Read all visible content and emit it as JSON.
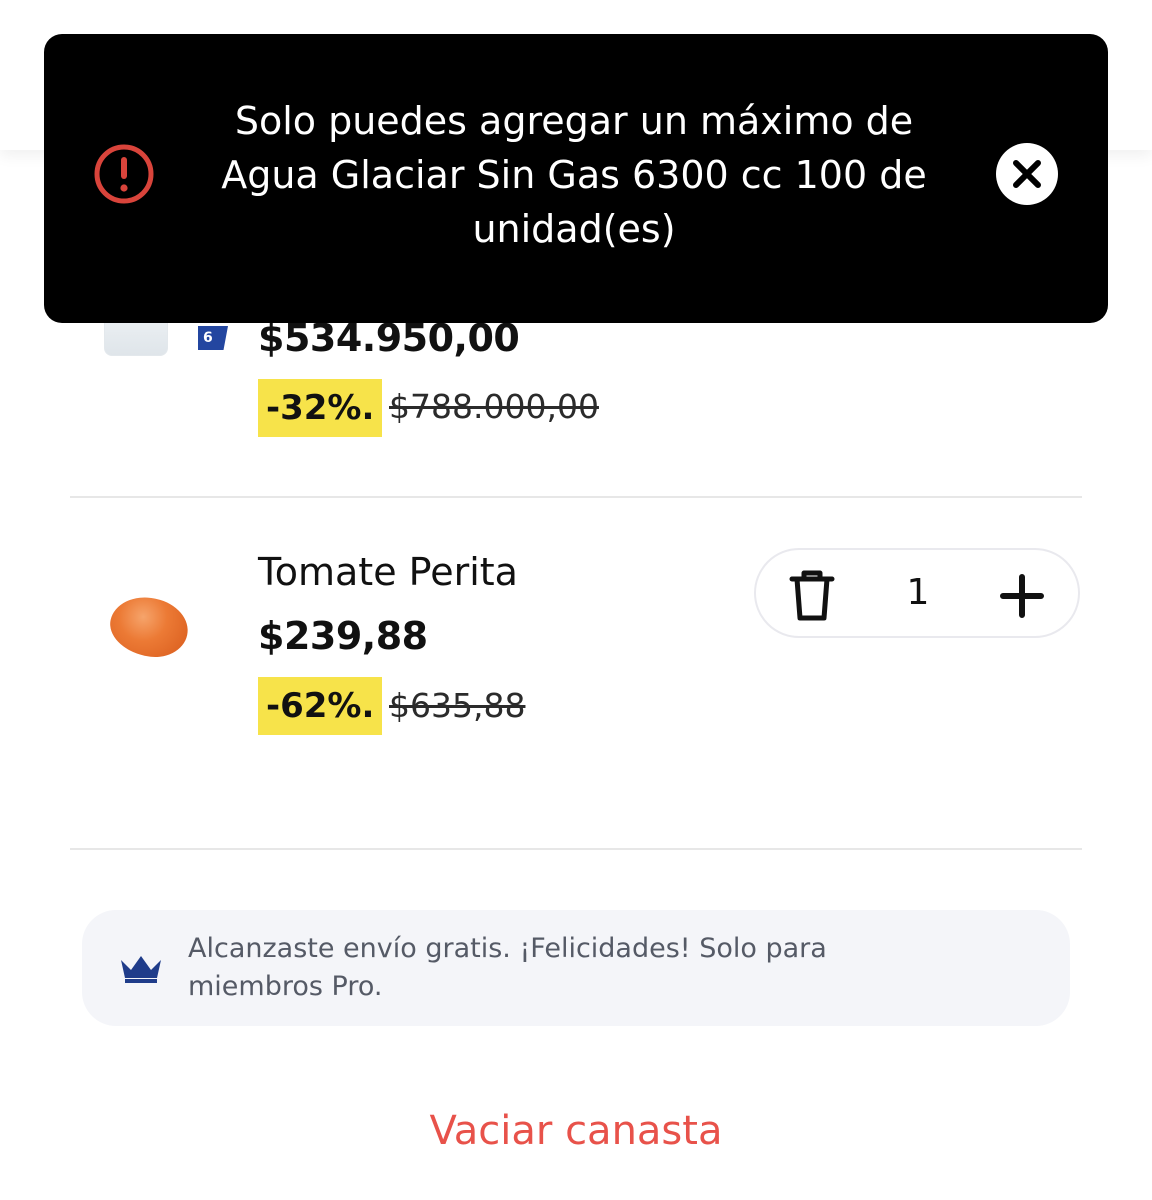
{
  "toast": {
    "message": "Solo puedes agregar un máximo de Agua Glaciar Sin Gas 6300 cc 100 de unidad(es)",
    "icon": "alert-circle-icon",
    "close_icon": "close-icon",
    "icon_color": "#d9443b"
  },
  "cart": {
    "items": [
      {
        "name": "Agua Glaciar Sin Gas 6300 cc",
        "tag": "6",
        "price": "$534.950,00",
        "discount": "-32%.",
        "original_price": "$788.000,00"
      },
      {
        "name": "Tomate Perita",
        "price": "$239,88",
        "discount": "-62%.",
        "original_price": "$635,88",
        "quantity": "1",
        "remove_icon": "trash-icon",
        "add_icon": "plus-icon"
      }
    ]
  },
  "promo": {
    "icon": "crown-icon",
    "text": "Alcanzaste envío gratis. ¡Felicidades! Solo para miembros Pro."
  },
  "actions": {
    "clear_basket": "Vaciar canasta"
  },
  "colors": {
    "discount_badge": "#f7e34a",
    "clear_basket": "#e8524a",
    "pro_crown": "#1f3c8a"
  }
}
